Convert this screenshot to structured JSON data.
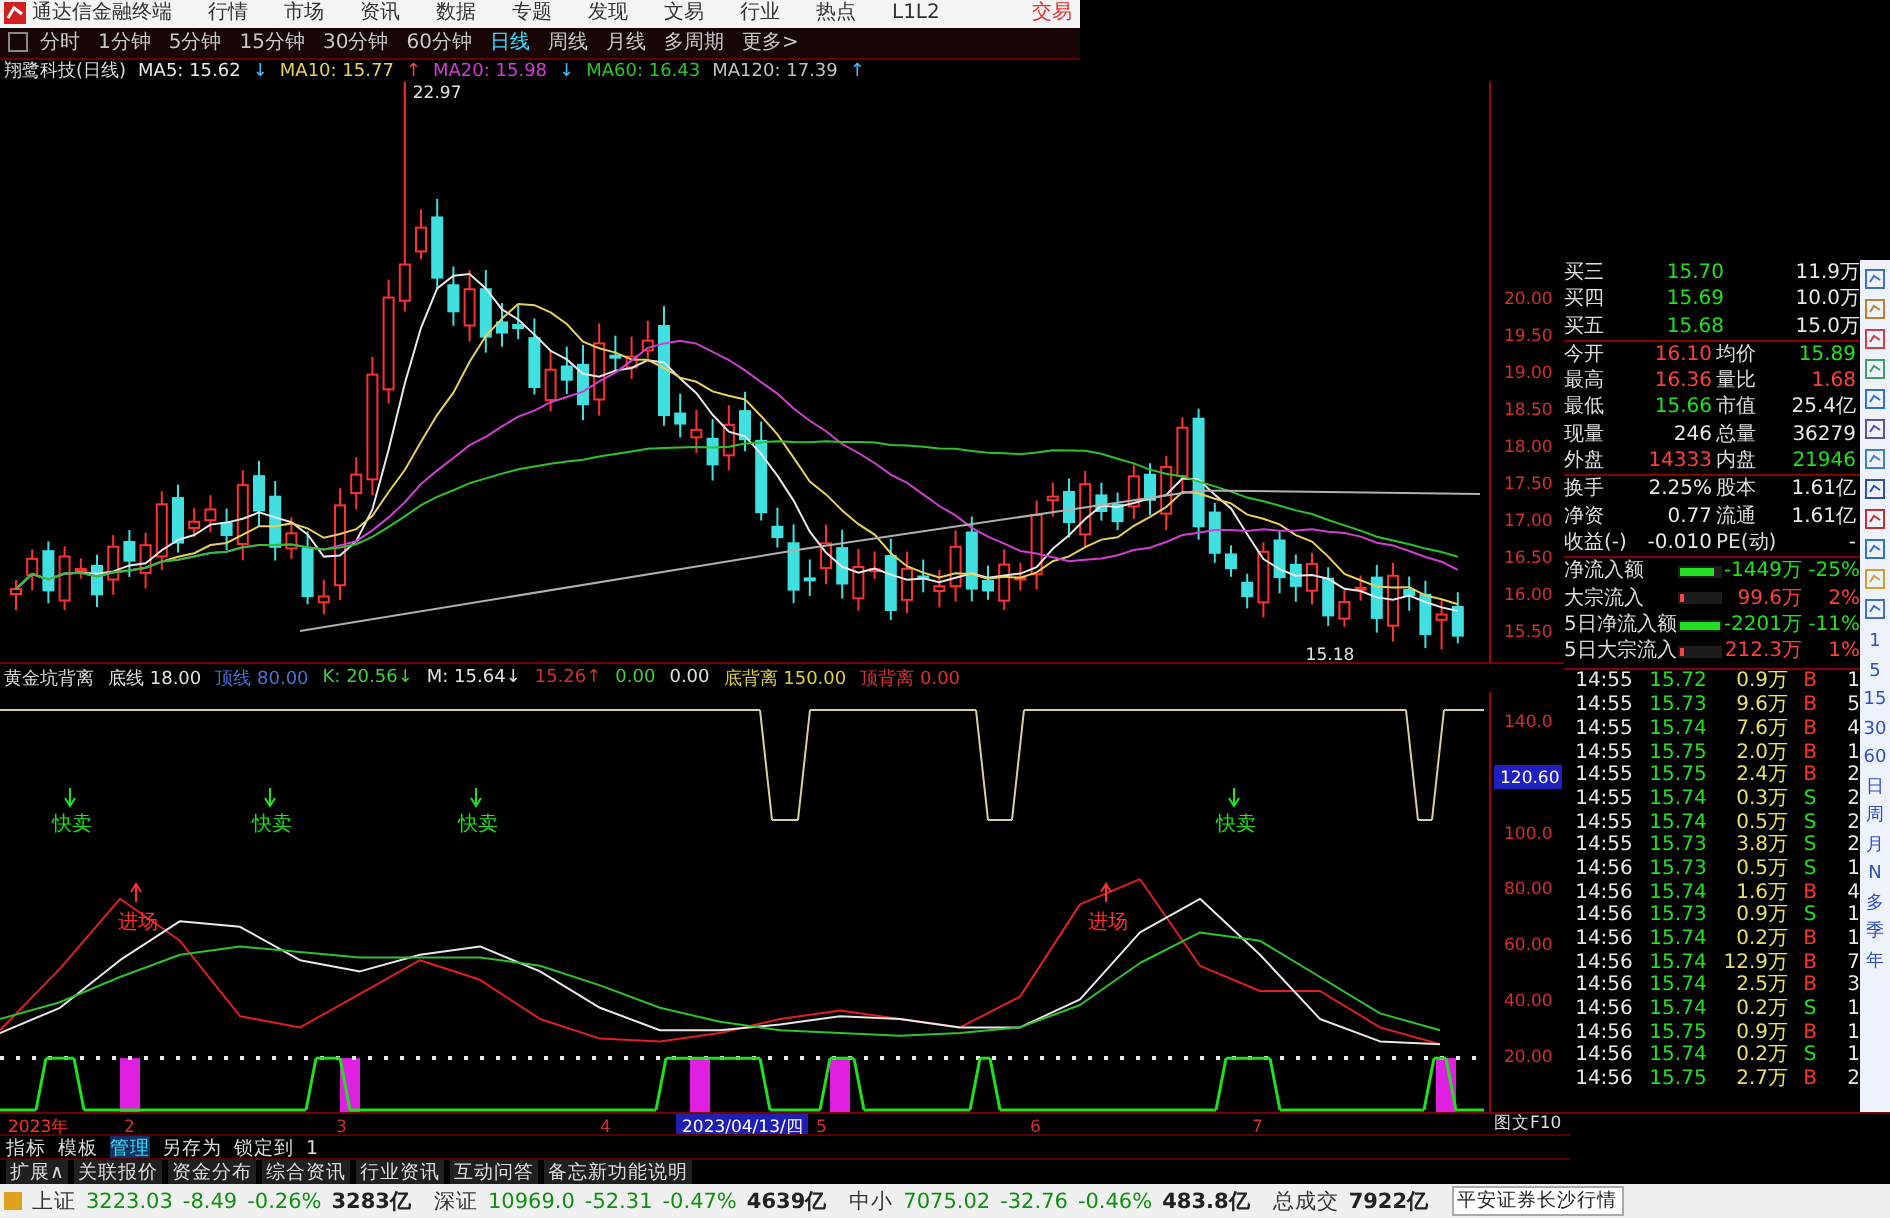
{
  "menubar": {
    "app_title": "通达信金融终端",
    "items": [
      "行情",
      "市场",
      "资讯",
      "数据",
      "专题",
      "发现",
      "文易",
      "行业",
      "热点",
      "L1L2"
    ],
    "trade": "交易"
  },
  "periods": [
    {
      "label": "分时",
      "selected": false
    },
    {
      "label": "1分钟",
      "selected": false
    },
    {
      "label": "5分钟",
      "selected": false
    },
    {
      "label": "15分钟",
      "selected": false
    },
    {
      "label": "30分钟",
      "selected": false
    },
    {
      "label": "60分钟",
      "selected": false
    },
    {
      "label": "日线",
      "selected": true
    },
    {
      "label": "周线",
      "selected": false
    },
    {
      "label": "月线",
      "selected": false
    },
    {
      "label": "多周期",
      "selected": false
    },
    {
      "label": "更多>",
      "selected": false
    }
  ],
  "legend": {
    "stock": "翔鹭科技(日线)",
    "mas": [
      {
        "label": "MA5: 15.62",
        "arrow": "↓",
        "color": "#e8e8e8"
      },
      {
        "label": "MA10: 15.77",
        "arrow": "↑",
        "color": "#e8d060"
      },
      {
        "label": "MA20: 15.98",
        "arrow": "↓",
        "color": "#d040d0"
      },
      {
        "label": "MA60: 16.43",
        "color": "#30c030"
      },
      {
        "label": "MA120: 17.39",
        "arrow": "↑",
        "color": "#c0c0c0"
      }
    ]
  },
  "main_chart": {
    "price_axis": [
      "20.00",
      "19.50",
      "19.00",
      "18.50",
      "18.00",
      "17.50",
      "17.00",
      "16.50",
      "16.00",
      "15.50"
    ],
    "high_label": "22.97",
    "low_label": "15.18"
  },
  "indicator": {
    "name": "黄金坑背离",
    "params": [
      {
        "text": "底线 18.00",
        "color": "#e0e0e0"
      },
      {
        "text": "顶线 80.00",
        "color": "#4a70d0"
      },
      {
        "text": "K: 20.56↓",
        "color": "#40d040"
      },
      {
        "text": "M: 15.64↓",
        "color": "#e0e0e0"
      },
      {
        "text": "15.26↑",
        "color": "#d03030"
      },
      {
        "text": "0.00",
        "color": "#40d040"
      },
      {
        "text": "0.00",
        "color": "#e0e0e0"
      },
      {
        "text": "底背离 150.00",
        "color": "#e0d040"
      },
      {
        "text": "顶背离 0.00",
        "color": "#e03030"
      }
    ]
  },
  "sub_chart": {
    "cursor_value": "120.60",
    "signals": [
      {
        "kind": "sell",
        "label": "快卖"
      },
      {
        "kind": "sell",
        "label": "快卖"
      },
      {
        "kind": "sell",
        "label": "快卖"
      },
      {
        "kind": "sell",
        "label": "快卖"
      },
      {
        "kind": "buy",
        "label": "进场"
      },
      {
        "kind": "buy",
        "label": "进场"
      }
    ],
    "chart_data": {
      "type": "line",
      "ylim": [
        0,
        151
      ],
      "yticks": [
        {
          "value": 140,
          "label": "140.0"
        },
        {
          "value": 100,
          "label": "100.0"
        },
        {
          "value": 80,
          "label": "80.00"
        },
        {
          "value": 60,
          "label": "60.00"
        },
        {
          "value": 40,
          "label": "40.00"
        },
        {
          "value": 20,
          "label": "20.00"
        }
      ],
      "series": [
        {
          "color": "#e02020",
          "values": [
            30,
            52,
            77,
            62,
            35,
            31,
            43,
            55,
            48,
            34,
            27,
            26,
            29,
            34,
            37,
            34,
            31,
            42,
            75,
            84,
            53,
            44,
            44,
            31,
            25
          ]
        },
        {
          "color": "#e8e8e8",
          "values": [
            29,
            38,
            55,
            69,
            67,
            55,
            51,
            57,
            60,
            51,
            38,
            30,
            30,
            32,
            35,
            34,
            31,
            31,
            41,
            65,
            77,
            57,
            34,
            26,
            25
          ]
        },
        {
          "color": "#30c030",
          "values": [
            34,
            40,
            49,
            57,
            60,
            58,
            56,
            56,
            56,
            53,
            46,
            38,
            33,
            30,
            29,
            28,
            29,
            31,
            39,
            54,
            65,
            62,
            49,
            36,
            30
          ]
        }
      ]
    }
  },
  "date_axis": [
    {
      "label": "2023年",
      "kind": "year"
    },
    {
      "label": "2",
      "kind": "month"
    },
    {
      "label": "3",
      "kind": "month"
    },
    {
      "label": "4",
      "kind": "month"
    },
    {
      "label": "2023/04/13/四",
      "kind": "cursor"
    },
    {
      "label": "5",
      "kind": "month"
    },
    {
      "label": "6",
      "kind": "month"
    },
    {
      "label": "7",
      "kind": "month"
    }
  ],
  "f10_button": "图文F10",
  "tools": [
    {
      "label": "指标",
      "selected": false
    },
    {
      "label": "模板",
      "selected": false
    },
    {
      "label": "管理",
      "selected": true
    },
    {
      "label": "另存为",
      "selected": false
    },
    {
      "label": "锁定到",
      "selected": false
    },
    {
      "label": "1",
      "selected": false
    }
  ],
  "tabs": [
    "扩展∧",
    "关联报价",
    "资金分布",
    "综合资讯",
    "行业资讯",
    "互动问答",
    "备忘新功能说明"
  ],
  "quote": {
    "bids": [
      {
        "label": "买三",
        "price": "15.70",
        "volume": "11.9万"
      },
      {
        "label": "买四",
        "price": "15.69",
        "volume": "10.0万"
      },
      {
        "label": "买五",
        "price": "15.68",
        "volume": "15.0万"
      }
    ],
    "stats": [
      {
        "left": {
          "label": "今开",
          "value": "16.10",
          "color": "#ff4040"
        },
        "right": {
          "label": "均价",
          "value": "15.89",
          "color": "#20e020"
        }
      },
      {
        "left": {
          "label": "最高",
          "value": "16.36",
          "color": "#ff4040"
        },
        "right": {
          "label": "量比",
          "value": "1.68",
          "color": "#ff4040"
        }
      },
      {
        "left": {
          "label": "最低",
          "value": "15.66",
          "color": "#20e020"
        },
        "right": {
          "label": "市值",
          "value": "25.4亿",
          "color": "#e8e8e8"
        }
      },
      {
        "left": {
          "label": "现量",
          "value": "246",
          "color": "#e8e8e8"
        },
        "right": {
          "label": "总量",
          "value": "36279",
          "color": "#e8e8e8"
        }
      },
      {
        "left": {
          "label": "外盘",
          "value": "14333",
          "color": "#ff4040"
        },
        "right": {
          "label": "内盘",
          "value": "21946",
          "color": "#20e020"
        }
      },
      {
        "left": {
          "label": "换手",
          "value": "2.25%",
          "color": "#e8e8e8"
        },
        "right": {
          "label": "股本",
          "value": "1.61亿",
          "color": "#e8e8e8"
        }
      },
      {
        "left": {
          "label": "净资",
          "value": "0.77",
          "color": "#e8e8e8"
        },
        "right": {
          "label": "流通",
          "value": "1.61亿",
          "color": "#e8e8e8"
        }
      },
      {
        "left": {
          "label": "收益(-)",
          "value": "-0.010",
          "color": "#e8e8e8"
        },
        "right": {
          "label": "PE(动)",
          "value": "-",
          "color": "#e8e8e8"
        }
      }
    ],
    "flows": [
      {
        "label": "净流入额",
        "value": "-1449万",
        "pct": "-25%",
        "color": "#20e020",
        "level": 0.85
      },
      {
        "label": "大宗流入",
        "value": "99.6万",
        "pct": "2%",
        "color": "#ff4040",
        "level": 0.1
      },
      {
        "label": "5日净流入额",
        "value": "-2201万",
        "pct": "-11%",
        "color": "#20e020",
        "level": 1
      },
      {
        "label": "5日大宗流入",
        "value": "212.3万",
        "pct": "1%",
        "color": "#ff4040",
        "level": 0.1
      }
    ],
    "ticks": [
      {
        "time": "14:55",
        "price": "15.72",
        "volume": "0.9万",
        "side": "B",
        "color": "#ff3030",
        "column_5": "1"
      },
      {
        "time": "14:55",
        "price": "15.73",
        "volume": "9.6万",
        "side": "B",
        "color": "#ff3030",
        "column_5": "5"
      },
      {
        "time": "14:55",
        "price": "15.74",
        "volume": "7.6万",
        "side": "B",
        "color": "#ff3030",
        "column_5": "4"
      },
      {
        "time": "14:55",
        "price": "15.75",
        "volume": "2.0万",
        "side": "B",
        "color": "#ff3030",
        "column_5": "1"
      },
      {
        "time": "14:55",
        "price": "15.75",
        "volume": "2.4万",
        "side": "B",
        "color": "#ff3030",
        "column_5": "2"
      },
      {
        "time": "14:55",
        "price": "15.74",
        "volume": "0.3万",
        "side": "S",
        "color": "#20e020",
        "column_5": "2"
      },
      {
        "time": "14:55",
        "price": "15.74",
        "volume": "0.5万",
        "side": "S",
        "color": "#20e020",
        "column_5": "2"
      },
      {
        "time": "14:55",
        "price": "15.73",
        "volume": "3.8万",
        "side": "S",
        "color": "#20e020",
        "column_5": "2"
      },
      {
        "time": "14:56",
        "price": "15.73",
        "volume": "0.5万",
        "side": "S",
        "color": "#20e020",
        "column_5": "1"
      },
      {
        "time": "14:56",
        "price": "15.74",
        "volume": "1.6万",
        "side": "B",
        "color": "#ff3030",
        "column_5": "4"
      },
      {
        "time": "14:56",
        "price": "15.73",
        "volume": "0.9万",
        "side": "S",
        "color": "#20e020",
        "column_5": "1"
      },
      {
        "time": "14:56",
        "price": "15.74",
        "volume": "0.2万",
        "side": "B",
        "color": "#ff3030",
        "column_5": "1"
      },
      {
        "time": "14:56",
        "price": "15.74",
        "volume": "12.9万",
        "side": "B",
        "color": "#ff3030",
        "column_5": "7"
      },
      {
        "time": "14:56",
        "price": "15.74",
        "volume": "2.5万",
        "side": "B",
        "color": "#ff3030",
        "column_5": "3"
      },
      {
        "time": "14:56",
        "price": "15.74",
        "volume": "0.2万",
        "side": "S",
        "color": "#20e020",
        "column_5": "1"
      },
      {
        "time": "14:56",
        "price": "15.75",
        "volume": "0.9万",
        "side": "B",
        "color": "#ff3030",
        "column_5": "1"
      },
      {
        "time": "14:56",
        "price": "15.74",
        "volume": "0.2万",
        "side": "S",
        "color": "#20e020",
        "column_5": "1"
      },
      {
        "time": "14:56",
        "price": "15.75",
        "volume": "2.7万",
        "side": "B",
        "color": "#ff3030",
        "column_5": "2"
      }
    ]
  },
  "side_periods": [
    "1",
    "5",
    "15",
    "30",
    "60",
    "日",
    "周",
    "月",
    "N",
    "多",
    "季",
    "年"
  ],
  "status_bar": {
    "indices": [
      {
        "name": "上证",
        "value": "3223.03",
        "change": "-8.49",
        "pct": "-0.26%",
        "amount": "3283亿"
      },
      {
        "name": "深证",
        "value": "10969.0",
        "change": "-52.31",
        "pct": "-0.47%",
        "amount": "4639亿"
      },
      {
        "name": "中小",
        "value": "7075.02",
        "change": "-32.76",
        "pct": "-0.46%",
        "amount": "483.8亿"
      }
    ],
    "total_label": "总成交",
    "total_value": "7922亿",
    "broker": "平安证券长沙行情"
  }
}
